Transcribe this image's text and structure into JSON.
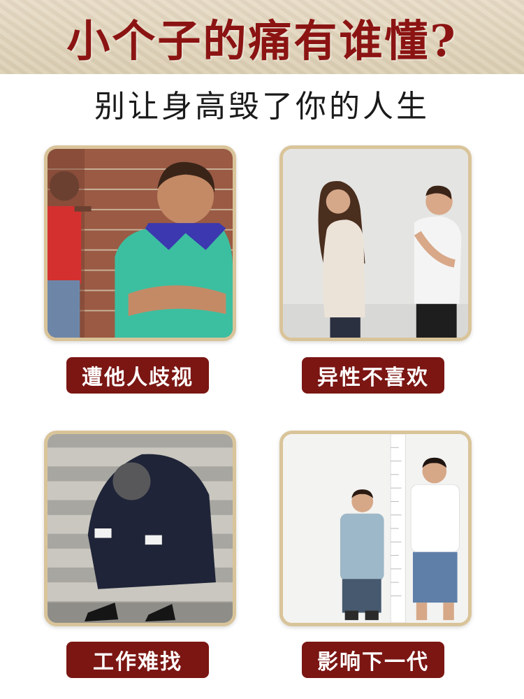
{
  "header": {
    "title": "小个子的痛有谁懂?"
  },
  "subtitle": "别让身高毁了你的人生",
  "cards": [
    {
      "label": "遭他人歧视"
    },
    {
      "label": "异性不喜欢"
    },
    {
      "label": "工作难找"
    },
    {
      "label": "影响下一代"
    }
  ],
  "colors": {
    "accent": "#8b1413",
    "label_bg": "#7b1613",
    "frame": "#d9c49a",
    "header_bg": "#e3d6bd"
  }
}
